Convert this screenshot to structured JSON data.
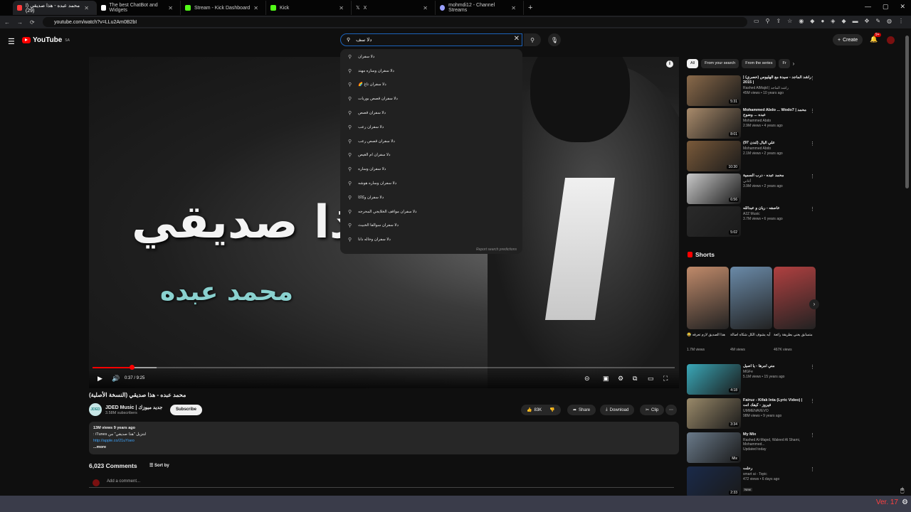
{
  "browser": {
    "tabs": [
      {
        "label": "محمد عبده - هذا صديقي (ا (29)",
        "color": "#ff3b3b"
      },
      {
        "label": "The best ChatBot and Widgets",
        "color": "#ffffff"
      },
      {
        "label": "Stream - Kick Dashboard",
        "color": "#53fc18"
      },
      {
        "label": "Kick",
        "color": "#53fc18"
      },
      {
        "label": "X",
        "color": "#ffffff"
      },
      {
        "label": "mohmdi12 - Channel Streams",
        "color": "#9aa0ff"
      }
    ],
    "url": "youtube.com/watch?v=LLu2Am0B2bI"
  },
  "header": {
    "logo_text": "YouTube",
    "country": "SA",
    "search_query": "دلا سف",
    "create_label": "Create",
    "bell_count": "9+"
  },
  "suggestions": [
    "دلا سفران",
    "دلا سفران وساره مهند",
    "دلا سفران تاغ 🌈",
    "دلا سفران قصص بوربات",
    "دلا سفران قصص",
    "دلا سفران رعب",
    "دلا سفران قصص رعب",
    "دلا سفران ام الغيص",
    "دلا سفران وساره",
    "دلا سفران وساره هوشه",
    "دلا سفران وكاكا",
    "دلا سفران مواقف الخلايجي المحرجه",
    "دلا سفران سوالفا الخبيث",
    "دلا سفران وخاله دانا"
  ],
  "report_label": "Report search predictions",
  "video": {
    "overlay_title": "هذا صديقي",
    "overlay_artist": "محمد عبده",
    "time": "0:37 / 9:25",
    "progress": 0.067,
    "buffered": 0.11,
    "title": "محمد عبده - هذا صديقي (النسخة الأصلية)"
  },
  "channel": {
    "avatar_text": "JDED",
    "name": "JDED Music | جديد ميوزك",
    "subs": "3.58M subscribers",
    "subscribe": "Subscribe",
    "likes": "83K",
    "share": "Share",
    "download": "Download",
    "clip": "Clip"
  },
  "description": {
    "stats": "13M views  9 years ago",
    "line1": "لتنزيل \"هذا صديقي\" من iTunes :",
    "link": "http://apple.co/21uYseo",
    "more": "...more"
  },
  "comments": {
    "count": "6,023 Comments",
    "sort": "Sort by",
    "placeholder": "Add a comment..."
  },
  "chips": [
    "All",
    "From your search",
    "From the series",
    "Fr"
  ],
  "recs_top": [
    {
      "title": "| راشد الماجد - سيدة مع الهليوس (حصري) | 2015",
      "channel": "Rashed AlMajid | راشد الماجد",
      "views": "45M views • 10 years ago",
      "duration": "5:31",
      "color": "#8a6a4a"
    },
    {
      "title": "Mohammed Abdo ... Wodo7 | محمد عبده ... وضوح",
      "channel": "Mohammed Abdo",
      "views": "2.9M views • 4 years ago",
      "duration": "8:01",
      "color": "#a98b6b"
    },
    {
      "title": "علي البال (لندن 97)",
      "channel": "Mohammed Abdo",
      "views": "2.1M views • 2 years ago",
      "duration": "10:30",
      "color": "#7a5a3a"
    },
    {
      "title": "محمد عبده - درب السمية",
      "channel": "أغاني",
      "views": "3.9M views • 2 years ago",
      "duration": "6:56",
      "color": "#c9c9c9"
    },
    {
      "title": "عاصفه - ريان و عبدالله",
      "channel": "A2Z Music",
      "views": "3.7M views • 6 years ago",
      "duration": "5:02",
      "color": "#2a2a2a"
    }
  ],
  "shorts_title": "Shorts",
  "shorts": [
    {
      "title": "هذا الصديق لازم تعرفه 😂",
      "views": "1.7M views",
      "color": "#c08a6a"
    },
    {
      "title": "أيه يشوف الكل شكاه اصالة",
      "views": "4M views",
      "color": "#6a8aa8"
    },
    {
      "title": "متسابق يغني بطريقة رائعة",
      "views": "467K views",
      "color": "#b04040"
    }
  ],
  "recs_bottom": [
    {
      "title": "مني امرها - يا اصيل",
      "channel": "MGFe",
      "views": "5.1M views • 15 years ago",
      "duration": "4:18",
      "color": "#3aa8b8",
      "tag": ""
    },
    {
      "title": "Fairuz - Kifak Inta (Lyric Video) | فيروز - كيفك انت",
      "channel": "UMMENAVEVO",
      "views": "98M views • 9 years ago",
      "duration": "3:34",
      "color": "#9a8a6a",
      "tag": ""
    },
    {
      "title": "My Mix",
      "channel": "Rashed Al-Majed, Waleed Al Shami, Mohammed...",
      "views": "Updated today",
      "duration": "Mix",
      "color": "#6a7a8a",
      "tag": ""
    },
    {
      "title": "رحلت",
      "channel": "smart ai - Topic",
      "views": "472 views • 6 days ago",
      "duration": "2:33",
      "color": "#1a2a4a",
      "tag": "New"
    }
  ],
  "version_label": "Ver. 17"
}
